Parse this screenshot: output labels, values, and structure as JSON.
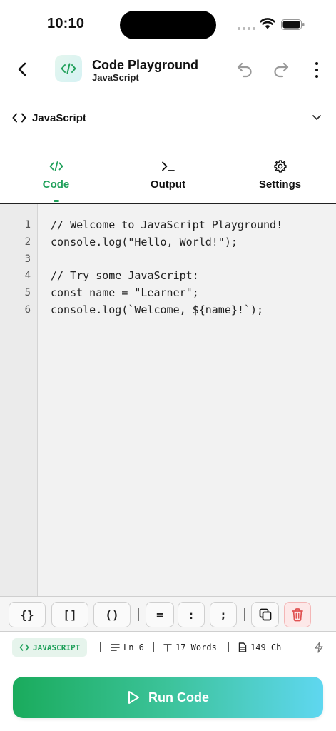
{
  "status_bar": {
    "time": "10:10"
  },
  "header": {
    "title": "Code Playground",
    "subtitle": "JavaScript"
  },
  "language_selector": {
    "label": "JavaScript",
    "icon": "code-brackets-icon"
  },
  "tabs": [
    {
      "label": "Code",
      "icon": "code-icon",
      "active": true
    },
    {
      "label": "Output",
      "icon": "terminal-icon",
      "active": false
    },
    {
      "label": "Settings",
      "icon": "gear-icon",
      "active": false
    }
  ],
  "editor": {
    "lines": [
      {
        "num": "1",
        "text": "// Welcome to JavaScript Playground!"
      },
      {
        "num": "2",
        "text": "console.log(\"Hello, World!\");"
      },
      {
        "num": "3",
        "text": ""
      },
      {
        "num": "4",
        "text": "// Try some JavaScript:"
      },
      {
        "num": "5",
        "text": "const name = \"Learner\";"
      },
      {
        "num": "6",
        "text": "console.log(`Welcome, ${name}!`);"
      }
    ]
  },
  "symbol_bar": {
    "braces": "{}",
    "brackets": "[]",
    "parens": "()",
    "equals": "=",
    "colon": ":",
    "semicolon": ";"
  },
  "status_line": {
    "language": "JAVASCRIPT",
    "line": "Ln 6",
    "words": "17 Words",
    "chars": "149 Ch"
  },
  "run_button": {
    "label": "Run Code"
  },
  "colors": {
    "accent": "#1fa05a",
    "run_gradient_start": "#1aab5c",
    "run_gradient_end": "#5fd7f0",
    "delete_red": "#e05252"
  }
}
